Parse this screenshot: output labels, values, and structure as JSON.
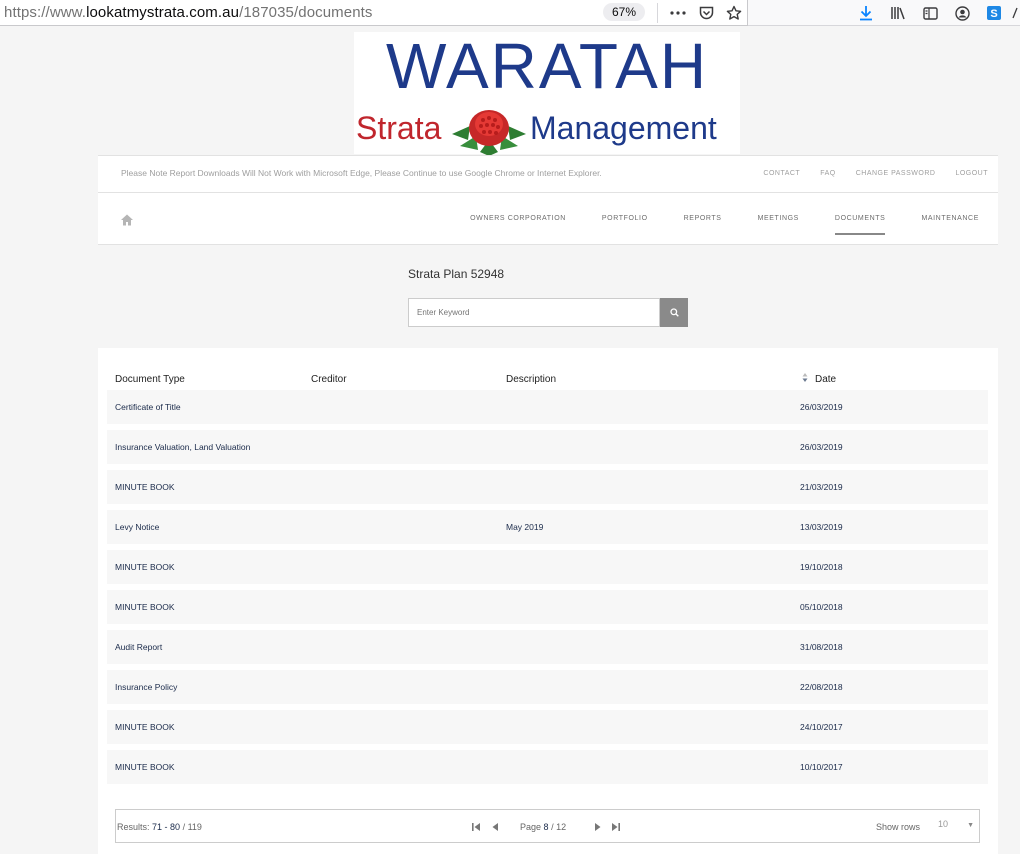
{
  "browser": {
    "url_prefix": "https://www.",
    "url_domain": "lookatmystrata.com.au",
    "url_path": "/187035/documents",
    "zoom": "67%"
  },
  "logo": {
    "word1": "WARATAH",
    "word2": "Strata",
    "word3": "Management"
  },
  "notice": "Please Note Report Downloads Will Not Work with Microsoft Edge, Please Continue to use Google Chrome or Internet Explorer.",
  "top_links": [
    "CONTACT",
    "FAQ",
    "CHANGE PASSWORD",
    "LOGOUT"
  ],
  "nav": [
    "OWNERS CORPORATION",
    "PORTFOLIO",
    "REPORTS",
    "MEETINGS",
    "DOCUMENTS",
    "MAINTENANCE"
  ],
  "nav_active": "DOCUMENTS",
  "plan_title": "Strata Plan 52948",
  "search": {
    "placeholder": "Enter Keyword"
  },
  "table": {
    "headers": [
      "Document Type",
      "Creditor",
      "Description",
      "Date"
    ],
    "rows": [
      {
        "type": "Certificate of Title",
        "creditor": "",
        "description": "",
        "date": "26/03/2019"
      },
      {
        "type": "Insurance Valuation, Land Valuation",
        "creditor": "",
        "description": "",
        "date": "26/03/2019"
      },
      {
        "type": "MINUTE BOOK",
        "creditor": "",
        "description": "",
        "date": "21/03/2019"
      },
      {
        "type": "Levy Notice",
        "creditor": "",
        "description": "May 2019",
        "date": "13/03/2019"
      },
      {
        "type": "MINUTE BOOK",
        "creditor": "",
        "description": "",
        "date": "19/10/2018"
      },
      {
        "type": "MINUTE BOOK",
        "creditor": "",
        "description": "",
        "date": "05/10/2018"
      },
      {
        "type": "Audit Report",
        "creditor": "",
        "description": "",
        "date": "31/08/2018"
      },
      {
        "type": "Insurance Policy",
        "creditor": "",
        "description": "",
        "date": "22/08/2018"
      },
      {
        "type": "MINUTE BOOK",
        "creditor": "",
        "description": "",
        "date": "24/10/2017"
      },
      {
        "type": "MINUTE BOOK",
        "creditor": "",
        "description": "",
        "date": "10/10/2017"
      }
    ]
  },
  "pager": {
    "results_label": "Results: ",
    "results_range": "71 - 80",
    "results_total": "/ 119",
    "page_label": "Page ",
    "page_current": "8",
    "page_total": "/ 12",
    "show_rows_label": "Show rows",
    "rows_value": "10"
  }
}
